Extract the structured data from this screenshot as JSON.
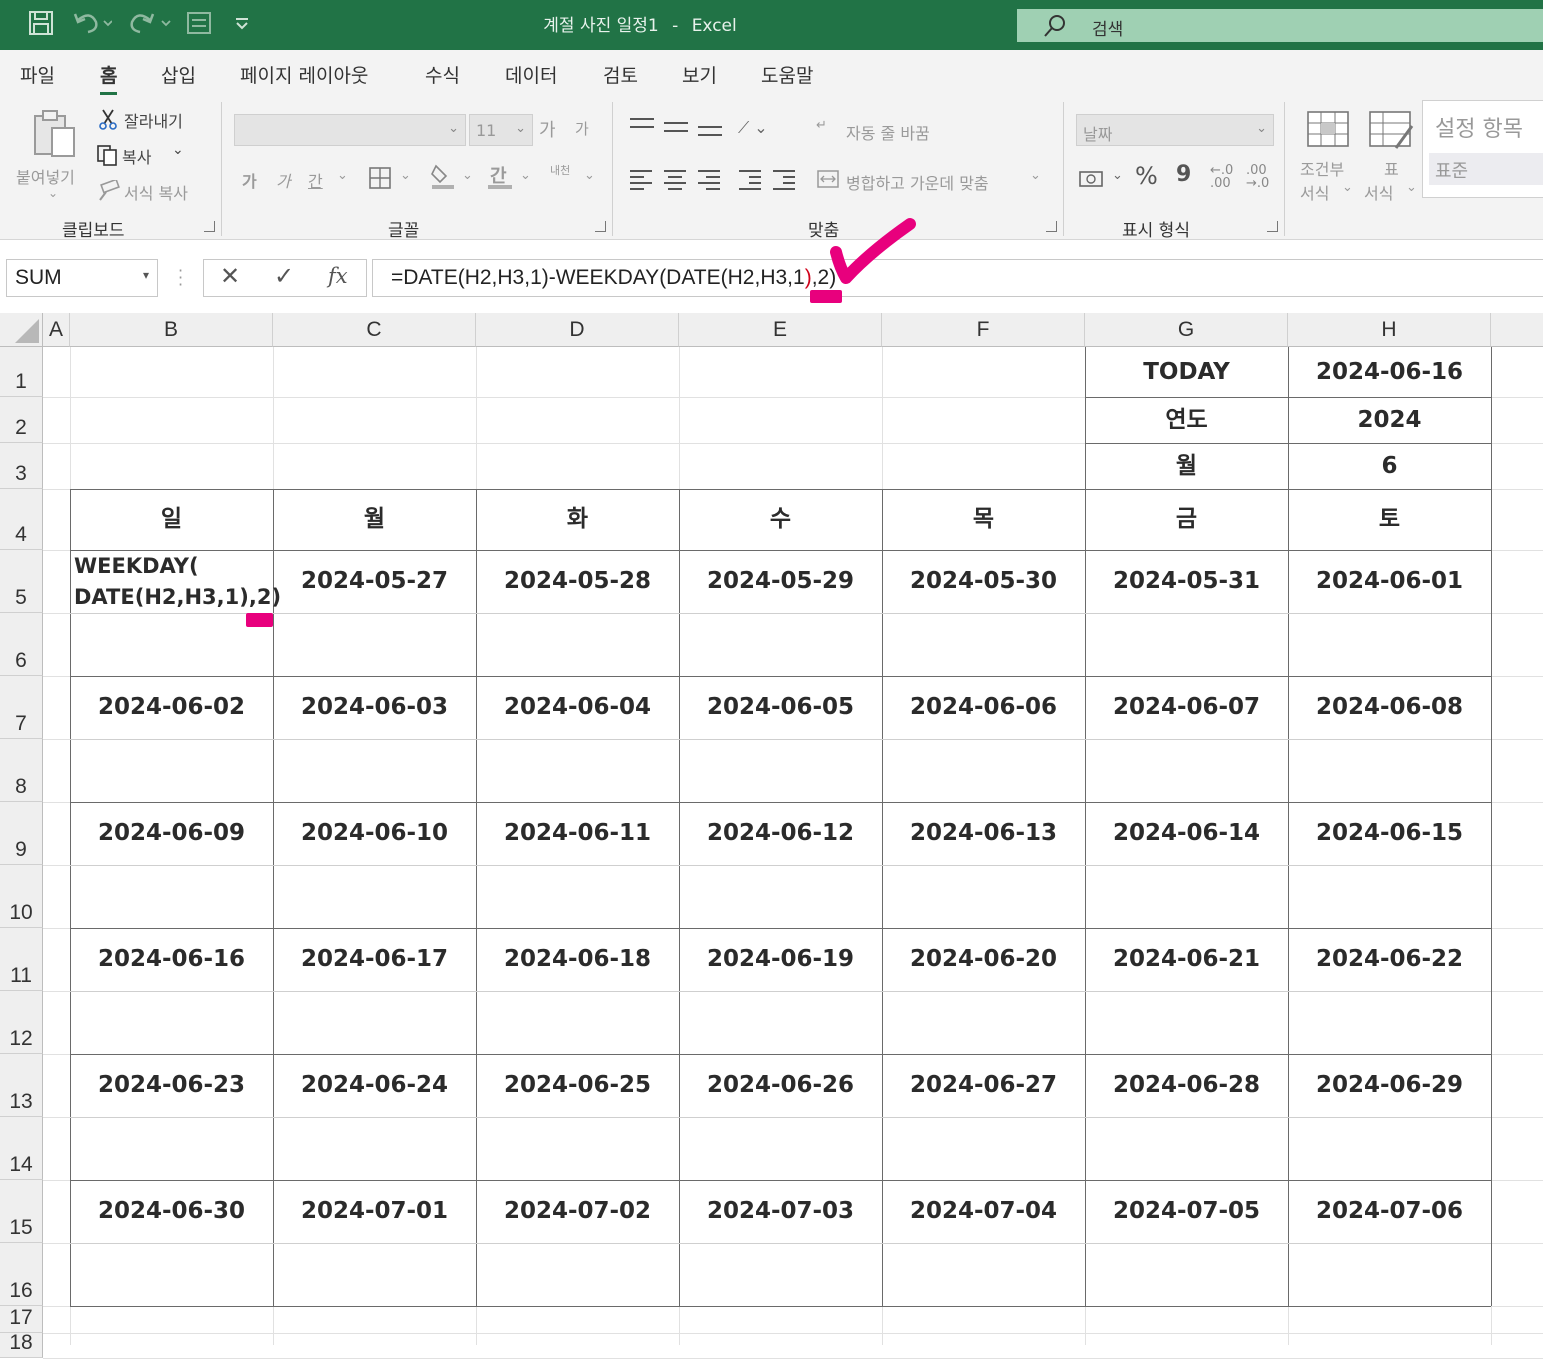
{
  "window": {
    "title": "계절 사진 일정1",
    "app": "Excel",
    "separator": "-",
    "search_placeholder": "검색"
  },
  "tabs": [
    "파일",
    "홈",
    "삽입",
    "페이지 레이아웃",
    "수식",
    "데이터",
    "검토",
    "보기",
    "도움말"
  ],
  "active_tab": "홈",
  "ribbon": {
    "clipboard": {
      "paste": "붙여넣기",
      "cut": "잘라내기",
      "copy": "복사",
      "format_painter": "서식 복사",
      "group": "클립보드"
    },
    "font": {
      "font_size": "11",
      "grow": "가",
      "shrink": "가",
      "bold": "가",
      "italic": "가",
      "underline": "간",
      "phonetic": "내천",
      "group": "글꼴"
    },
    "alignment": {
      "wrap_text": "자동 줄 바꿈",
      "merge_center": "병합하고 가운데 맞춤",
      "group": "맞춤"
    },
    "number": {
      "format": "날짜",
      "percent": "%",
      "comma": "9",
      "group": "표시 형식"
    },
    "styles": {
      "conditional_line1": "조건부",
      "conditional_line2": "서식",
      "table_line1": "표",
      "table_line2": "서식",
      "cell_styles_title": "설정 항목",
      "normal": "표준"
    }
  },
  "formula_bar": {
    "name_box": "SUM",
    "cancel": "✕",
    "enter": "✓",
    "fx": "fx",
    "formula_part1": "=DATE(H2,H3,1)-WEEKDAY(DATE(",
    "formula_part2": "H2,H3,1",
    "formula_part3": ")",
    "formula_part4": ",2)"
  },
  "sheet": {
    "columns": [
      "A",
      "B",
      "C",
      "D",
      "E",
      "F",
      "G",
      "H"
    ],
    "rows": [
      "1",
      "2",
      "3",
      "4",
      "5",
      "6",
      "7",
      "8",
      "9",
      "10",
      "11",
      "12",
      "13",
      "14",
      "15",
      "16",
      "17",
      "18"
    ],
    "info": [
      {
        "label": "TODAY",
        "value": "2024-06-16"
      },
      {
        "label": "연도",
        "value": "2024"
      },
      {
        "label": "월",
        "value": "6"
      }
    ],
    "weekdays": [
      "일",
      "월",
      "화",
      "수",
      "목",
      "금",
      "토"
    ],
    "editing_cell_line1": "WEEKDAY(",
    "editing_cell_line2": "DATE(H2,H3,1),2)",
    "weeks": [
      [
        "",
        "2024-05-27",
        "2024-05-28",
        "2024-05-29",
        "2024-05-30",
        "2024-05-31",
        "2024-06-01"
      ],
      [
        "2024-06-02",
        "2024-06-03",
        "2024-06-04",
        "2024-06-05",
        "2024-06-06",
        "2024-06-07",
        "2024-06-08"
      ],
      [
        "2024-06-09",
        "2024-06-10",
        "2024-06-11",
        "2024-06-12",
        "2024-06-13",
        "2024-06-14",
        "2024-06-15"
      ],
      [
        "2024-06-16",
        "2024-06-17",
        "2024-06-18",
        "2024-06-19",
        "2024-06-20",
        "2024-06-21",
        "2024-06-22"
      ],
      [
        "2024-06-23",
        "2024-06-24",
        "2024-06-25",
        "2024-06-26",
        "2024-06-27",
        "2024-06-28",
        "2024-06-29"
      ],
      [
        "2024-06-30",
        "2024-07-01",
        "2024-07-02",
        "2024-07-03",
        "2024-07-04",
        "2024-07-05",
        "2024-07-06"
      ]
    ]
  },
  "annotation_color": "#e8007d",
  "brand_color": "#217346"
}
